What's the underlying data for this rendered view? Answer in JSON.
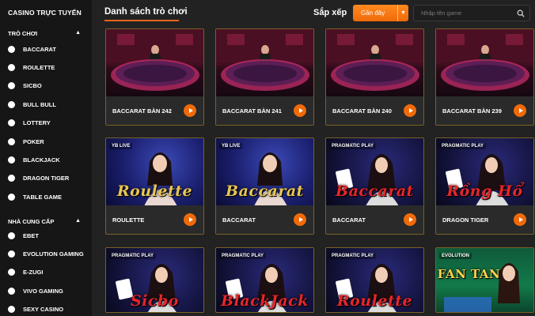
{
  "sidebar": {
    "title": "CASINO TRỰC TUYẾN",
    "games_section": "TRÒ CHƠI",
    "games": [
      "BACCARAT",
      "ROULETTE",
      "SICBO",
      "BULL BULL",
      "LOTTERY",
      "POKER",
      "BLACKJACK",
      "DRAGON TIGER",
      "TABLE GAME"
    ],
    "providers_section": "NHÀ CUNG CẤP",
    "providers": [
      "EBET",
      "EVOLUTION GAMING",
      "E-ZUGI",
      "VIVO GAMING",
      "SEXY CASINO"
    ]
  },
  "header": {
    "tab": "Danh sách trò chơi",
    "sort_label": "Sắp xếp",
    "sort_value": "Gần đây",
    "search_placeholder": "Nhập tên game"
  },
  "cards": [
    {
      "name": "BACCARAT BÀN 242",
      "brand": "",
      "art": ""
    },
    {
      "name": "BACCARAT BÀN 241",
      "brand": "",
      "art": ""
    },
    {
      "name": "BACCARAT BÀN 240",
      "brand": "",
      "art": ""
    },
    {
      "name": "BACCARAT BÀN 239",
      "brand": "",
      "art": ""
    },
    {
      "name": "ROULETTE",
      "brand": "YB LIVE",
      "art": "Roulette"
    },
    {
      "name": "BACCARAT",
      "brand": "YB LIVE",
      "art": "Baccarat"
    },
    {
      "name": "BACCARAT",
      "brand": "PRAGMATIC PLAY",
      "art": "Baccarat"
    },
    {
      "name": "DRAGON TIGER",
      "brand": "PRAGMATIC PLAY",
      "art": "Rồng Hổ"
    },
    {
      "name": "",
      "brand": "PRAGMATIC PLAY",
      "art": "Sicbo"
    },
    {
      "name": "",
      "brand": "PRAGMATIC PLAY",
      "art": "BlackJack"
    },
    {
      "name": "",
      "brand": "PRAGMATIC PLAY",
      "art": "Roulette"
    },
    {
      "name": "",
      "brand": "EVOLUTION",
      "art": "FAN TAN"
    }
  ],
  "colors": {
    "accent": "#f06a0a",
    "card_border": "#7a6126",
    "yb_art": "#e7c657",
    "pragmatic_art": "#e8262a",
    "fantan_art": "#ffd24a"
  }
}
